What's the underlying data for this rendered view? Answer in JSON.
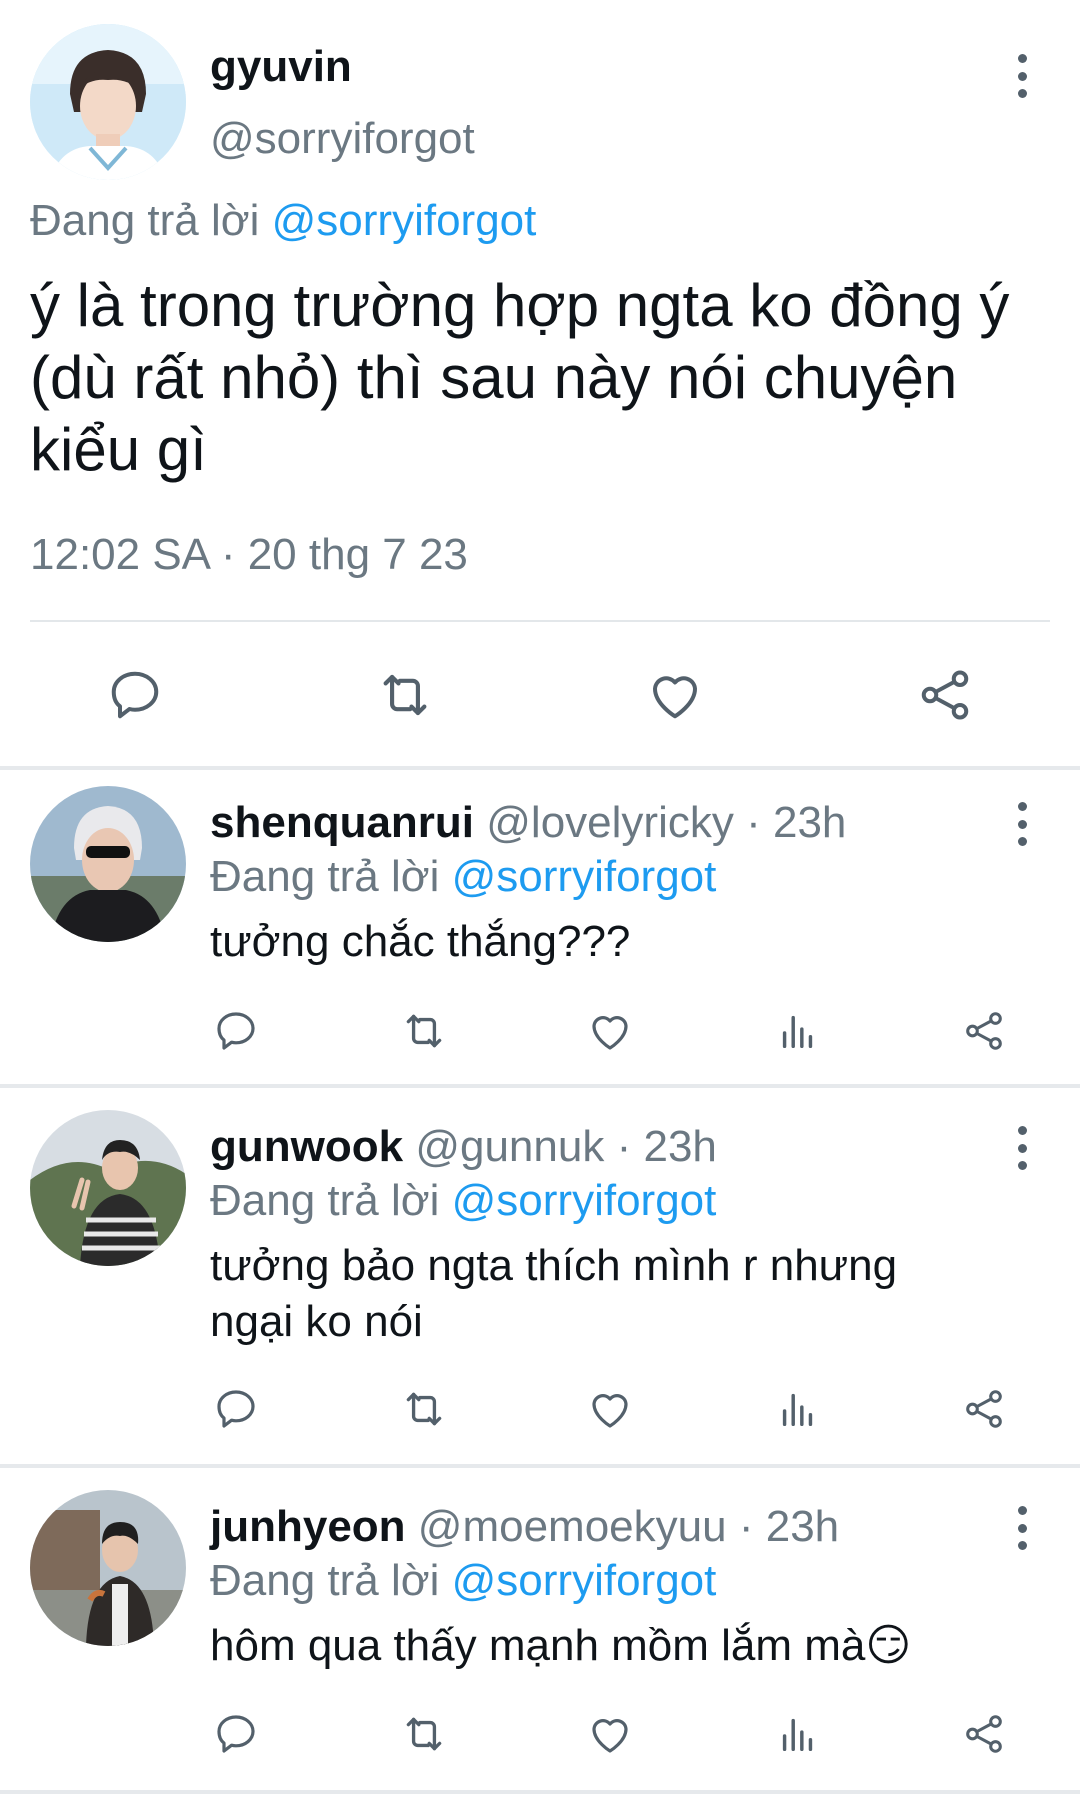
{
  "main_tweet": {
    "avatar": "profile-photo",
    "display_name": "gyuvin",
    "handle": "@sorryiforgot",
    "replying_prefix": "Đang trả lời",
    "replying_to": "@sorryiforgot",
    "text": "ý là trong trường hợp ngta ko đồng ý (dù rất nhỏ) thì sau này nói chuyện kiểu gì",
    "timestamp": "12:02 SA · 20 thg 7 23",
    "actions": [
      "reply-icon",
      "retweet-icon",
      "like-icon",
      "share-icon"
    ]
  },
  "replies": [
    {
      "display_name": "shenquanrui",
      "handle": "@lovelyricky",
      "separator": "·",
      "time": "23h",
      "replying_prefix": "Đang trả lời",
      "replying_to": "@sorryiforgot",
      "text": "tưởng chắc thắng???"
    },
    {
      "display_name": "gunwook",
      "handle": "@gunnuk",
      "separator": "·",
      "time": "23h",
      "replying_prefix": "Đang trả lời",
      "replying_to": "@sorryiforgot",
      "text": "tưởng bảo ngta thích mình r nhưng ngại ko nói"
    },
    {
      "display_name": "junhyeon",
      "handle": "@moemoekyuu",
      "separator": "·",
      "time": "23h",
      "replying_prefix": "Đang trả lời",
      "replying_to": "@sorryiforgot",
      "text": "hôm qua thấy mạnh mồm lắm mà😏"
    }
  ],
  "reply_actions": [
    "reply-icon",
    "retweet-icon",
    "like-icon",
    "views-icon",
    "share-icon"
  ],
  "colors": {
    "link": "#1d9bf0",
    "secondary": "#6b7882",
    "icon": "#53606b"
  }
}
